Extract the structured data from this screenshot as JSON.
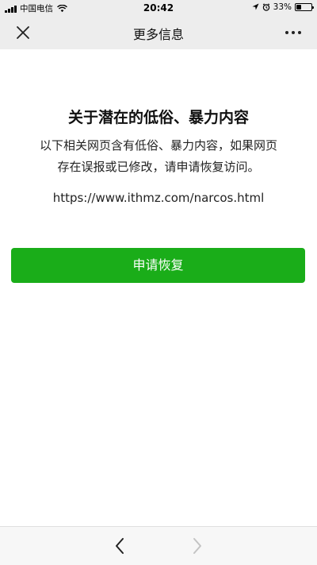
{
  "status_bar": {
    "carrier": "中国电信",
    "time": "20:42",
    "battery_percent": "33%",
    "battery_level": 0.33
  },
  "nav": {
    "title": "更多信息",
    "close_icon": "close-icon",
    "more_icon": "more-icon"
  },
  "content": {
    "title": "关于潜在的低俗、暴力内容",
    "description": "以下相关网页含有低俗、暴力内容，如果网页存在误报或已修改，请申请恢复访问。",
    "url": "https://www.ithmz.com/narcos.html",
    "restore_button_label": "申请恢复"
  },
  "colors": {
    "primary_green": "#1aad19",
    "bar_background": "#ededed"
  },
  "toolbar": {
    "back_icon": "chevron-left-icon",
    "forward_icon": "chevron-right-icon"
  }
}
